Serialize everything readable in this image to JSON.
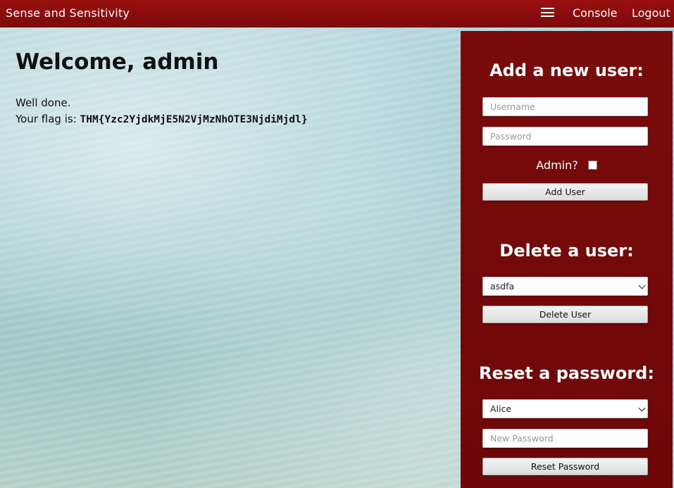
{
  "header": {
    "brand": "Sense and Sensitivity",
    "menu_icon": "hamburger-menu-icon",
    "nav": [
      "Console",
      "Logout"
    ]
  },
  "main": {
    "welcome": "Welcome, admin",
    "message": "Well done.",
    "flag_prefix": "Your flag is:",
    "flag_value": "THM{Yzc2YjdkMjE5N2VjMzNhOTE3NjdiMjdl}"
  },
  "add_user": {
    "title": "Add a new user:",
    "username_placeholder": "Username",
    "password_placeholder": "Password",
    "admin_label": "Admin?",
    "admin_checked": false,
    "button": "Add User"
  },
  "delete_user": {
    "title": "Delete a user:",
    "selected": "asdfa",
    "button": "Delete User"
  },
  "reset_password": {
    "title": "Reset a password:",
    "selected": "Alice",
    "new_password_placeholder": "New Password",
    "button": "Reset Password"
  },
  "colors": {
    "header_bg": "#8b0d0d",
    "panel_bg": "#740a0a",
    "text_light": "#ffffff"
  }
}
